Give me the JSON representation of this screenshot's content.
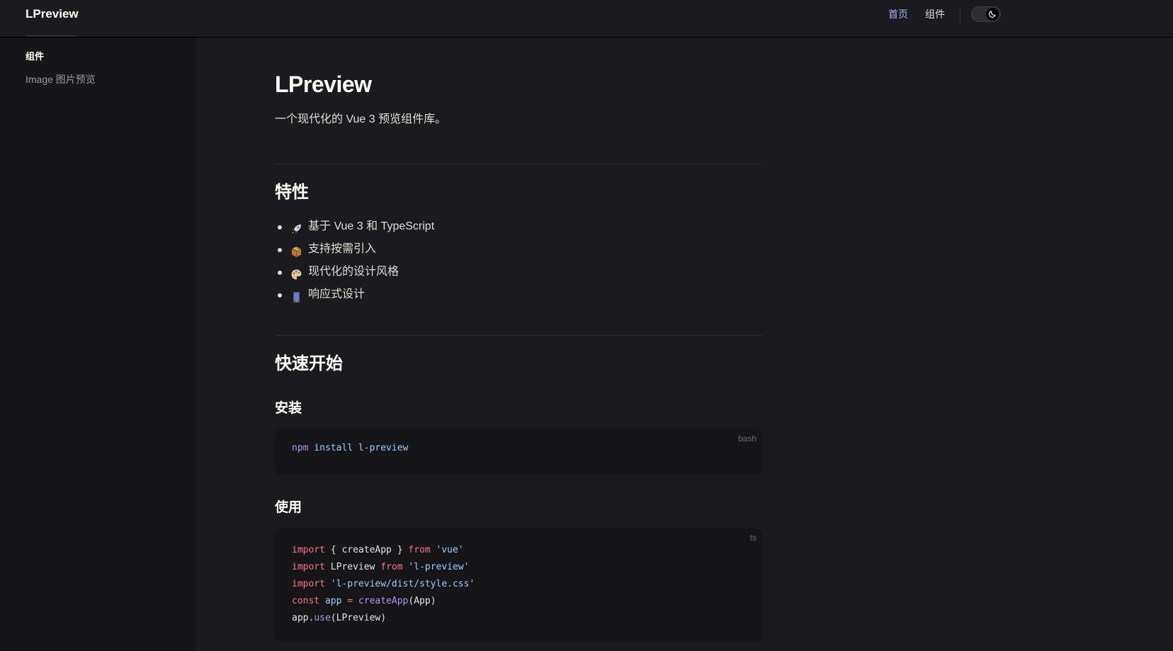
{
  "navbar": {
    "title": "LPreview",
    "links": [
      {
        "label": "首页"
      },
      {
        "label": "组件"
      }
    ],
    "theme_icon": "moon-icon"
  },
  "sidebar": {
    "group_title": "组件",
    "items": [
      {
        "label": "Image 图片预览"
      }
    ]
  },
  "main": {
    "title": "LPreview",
    "description": "一个现代化的 Vue 3 预览组件库。",
    "features_heading": "特性",
    "features": [
      {
        "icon": "rocket-icon",
        "text": "基于 Vue 3 和 TypeScript"
      },
      {
        "icon": "package-icon",
        "text": "支持按需引入"
      },
      {
        "icon": "palette-icon",
        "text": "现代化的设计风格"
      },
      {
        "icon": "mobile-phone-icon",
        "text": "响应式设计"
      }
    ],
    "quickstart_heading": "快速开始",
    "install_heading": "安装",
    "install_code": {
      "lang": "bash",
      "lines": [
        [
          {
            "t": "npm",
            "c": "cmd"
          },
          {
            "t": " install l-preview",
            "c": "str"
          }
        ]
      ]
    },
    "usage_heading": "使用",
    "usage_code": {
      "lang": "ts",
      "lines": [
        [
          {
            "t": "import",
            "c": "kw"
          },
          {
            "t": " { createApp } ",
            "c": "id"
          },
          {
            "t": "from",
            "c": "kw"
          },
          {
            "t": " 'vue'",
            "c": "str"
          }
        ],
        [
          {
            "t": "import",
            "c": "kw"
          },
          {
            "t": " LPreview ",
            "c": "id"
          },
          {
            "t": "from",
            "c": "kw"
          },
          {
            "t": " 'l-preview'",
            "c": "str"
          }
        ],
        [
          {
            "t": "import",
            "c": "kw"
          },
          {
            "t": " 'l-preview/dist/style.css'",
            "c": "str"
          }
        ],
        [
          {
            "t": "const",
            "c": "kw"
          },
          {
            "t": " app",
            "c": "str"
          },
          {
            "t": " = ",
            "c": "kw"
          },
          {
            "t": "createApp",
            "c": "fn"
          },
          {
            "t": "(App)",
            "c": "id"
          }
        ],
        [
          {
            "t": "app.",
            "c": "id"
          },
          {
            "t": "use",
            "c": "fn"
          },
          {
            "t": "(LPreview)",
            "c": "id"
          }
        ]
      ]
    }
  },
  "colors": {
    "background": "#1b1b1f",
    "sidebar": "#161618",
    "accent": "#a8b1ff",
    "text": "#dfdfd6"
  }
}
